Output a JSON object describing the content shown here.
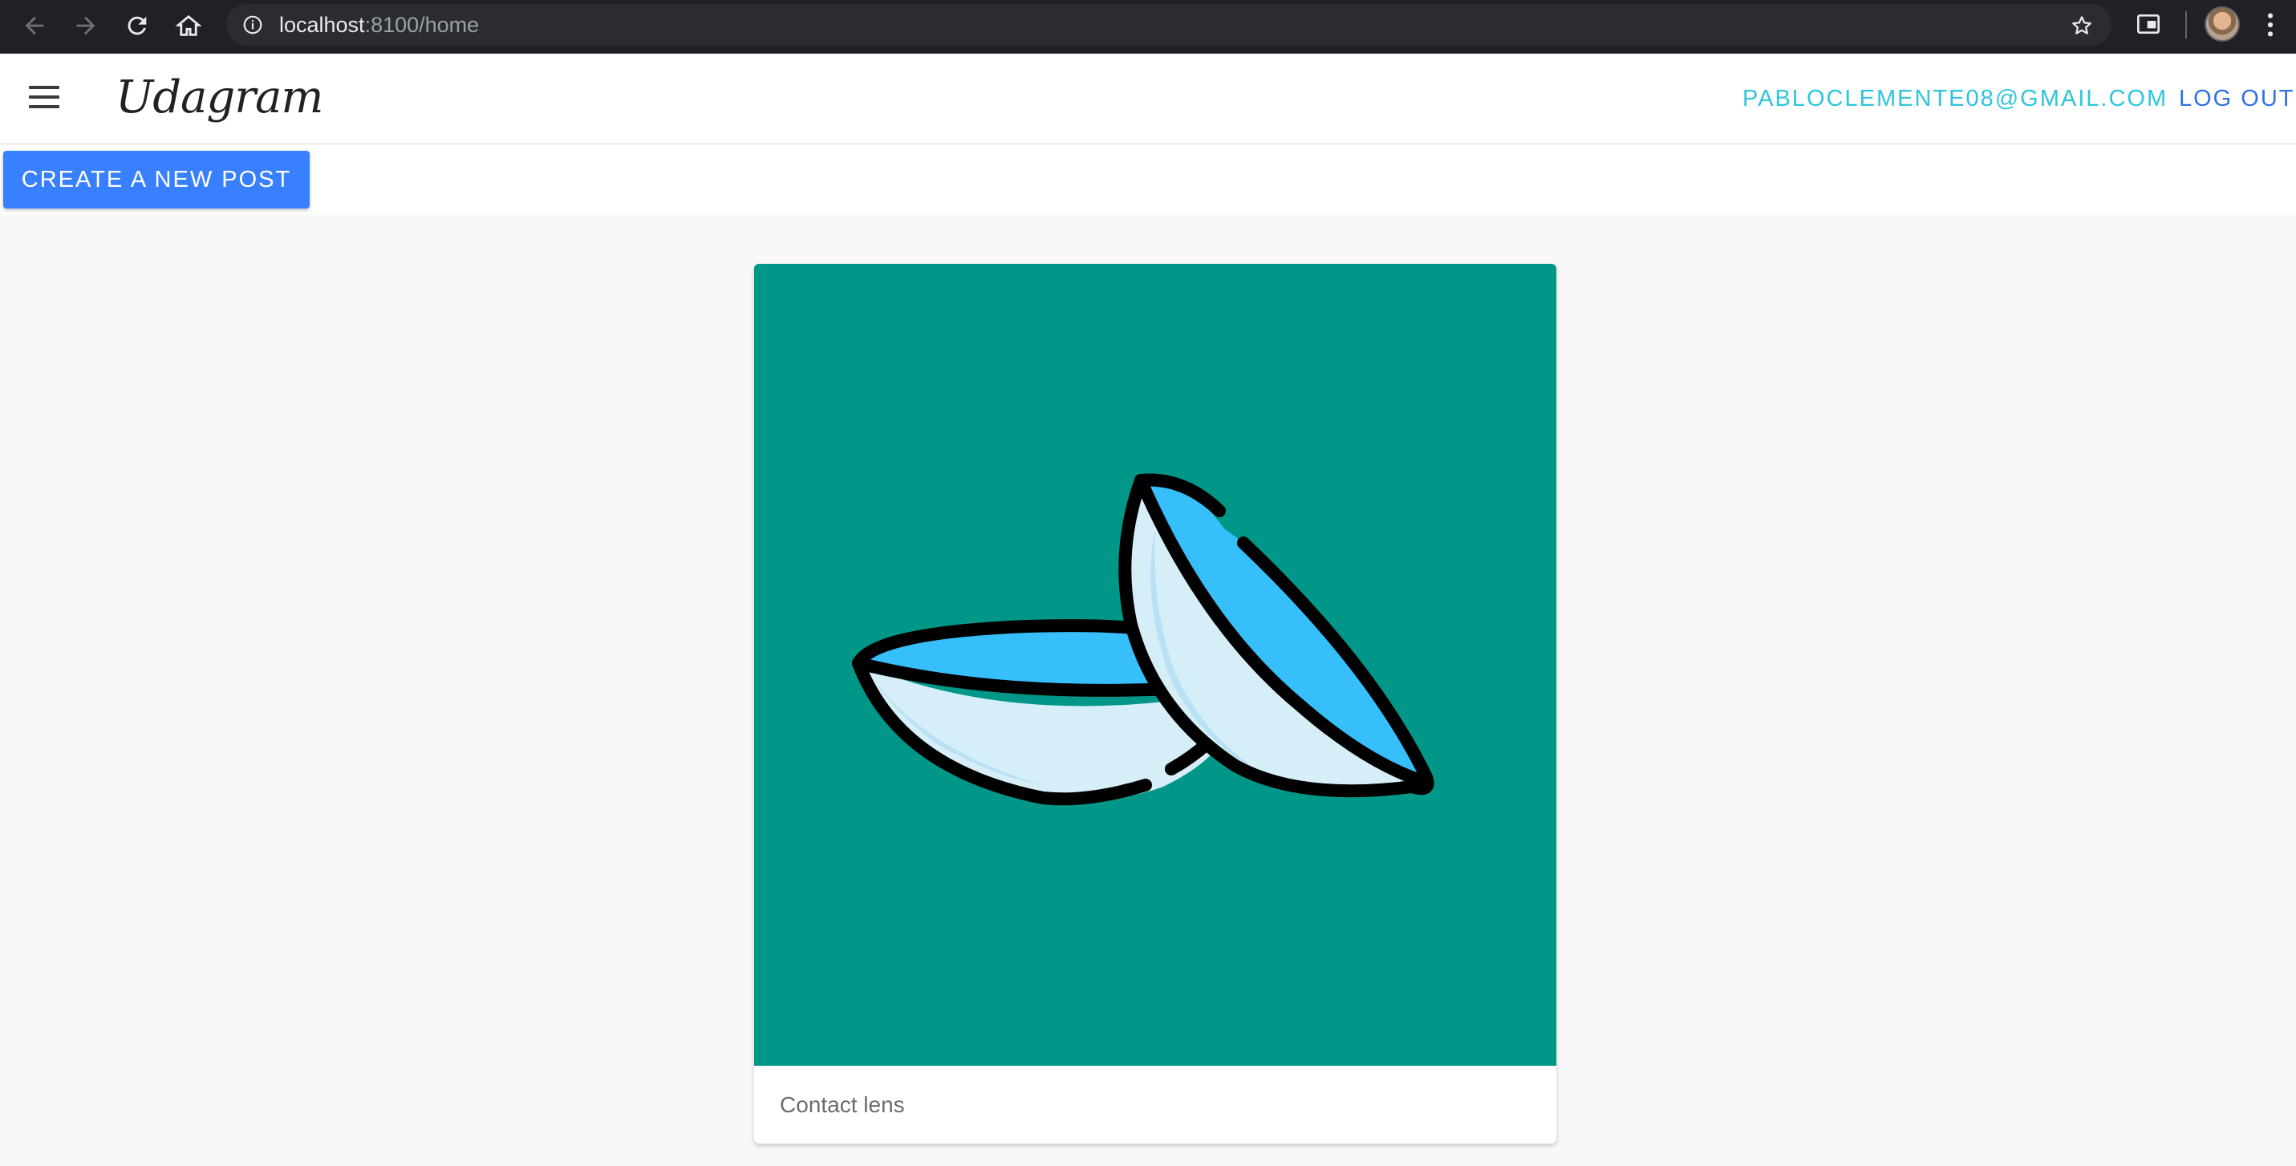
{
  "browser": {
    "url_host": "localhost",
    "url_rest": ":8100/home",
    "icons": [
      "back-icon",
      "forward-icon",
      "reload-icon",
      "home-icon",
      "info-icon",
      "star-icon",
      "extension-icon",
      "avatar",
      "more-icon"
    ]
  },
  "header": {
    "brand": "Udagram",
    "user_email": "PABLOCLEMENTE08@GMAIL.COM",
    "logout_label": "LOG OUT"
  },
  "toolbar": {
    "create_label": "CREATE A NEW POST"
  },
  "feed": {
    "posts": [
      {
        "caption": "Contact lens"
      }
    ]
  },
  "colors": {
    "accent": "#3880ff",
    "email": "#2ec5dc",
    "logout": "#3171e0",
    "card_bg": "#009688"
  }
}
